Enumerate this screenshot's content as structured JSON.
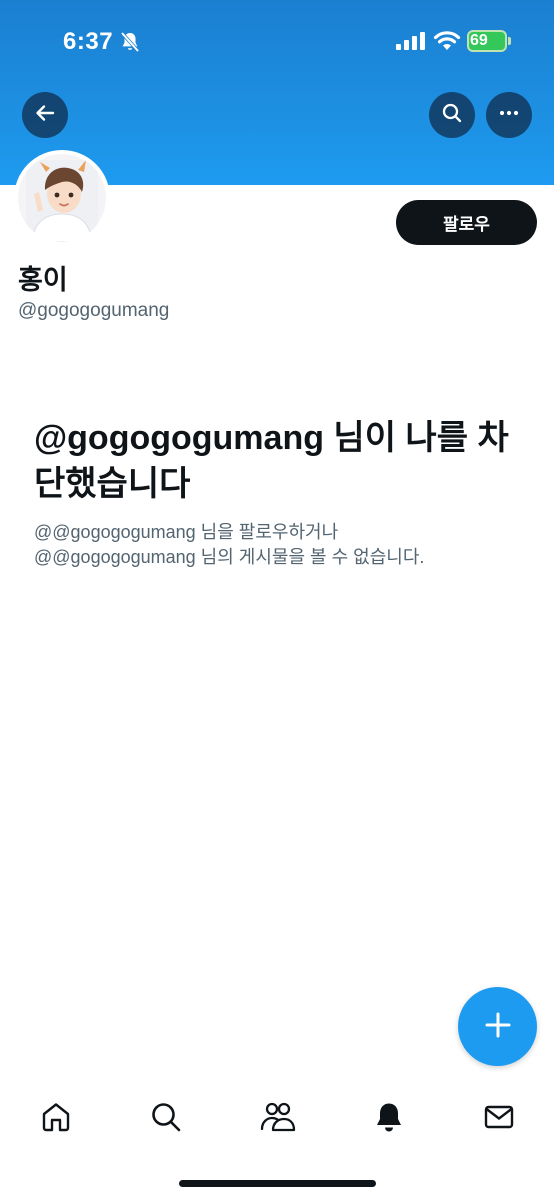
{
  "status_bar": {
    "time": "6:37",
    "battery": "69"
  },
  "profile": {
    "display_name": "홍이",
    "handle": "@gogogogumang",
    "follow_label": "팔로우"
  },
  "blocked": {
    "title": "@gogogogumang 님이 나를 차단했습니다",
    "line1": "@@gogogogumang 님을 팔로우하거나",
    "line2": "@@gogogogumang 님의 게시물을 볼 수 없습니다."
  },
  "icons": {
    "back": "arrow-left-icon",
    "search": "search-icon",
    "more": "more-horizontal-icon",
    "compose": "plus-icon",
    "nav": [
      "home-icon",
      "search-icon",
      "communities-icon",
      "bell-icon",
      "mail-icon"
    ]
  },
  "colors": {
    "accent": "#1d9bf0",
    "text_primary": "#0f1419",
    "text_secondary": "#536471",
    "battery": "#34c759"
  }
}
